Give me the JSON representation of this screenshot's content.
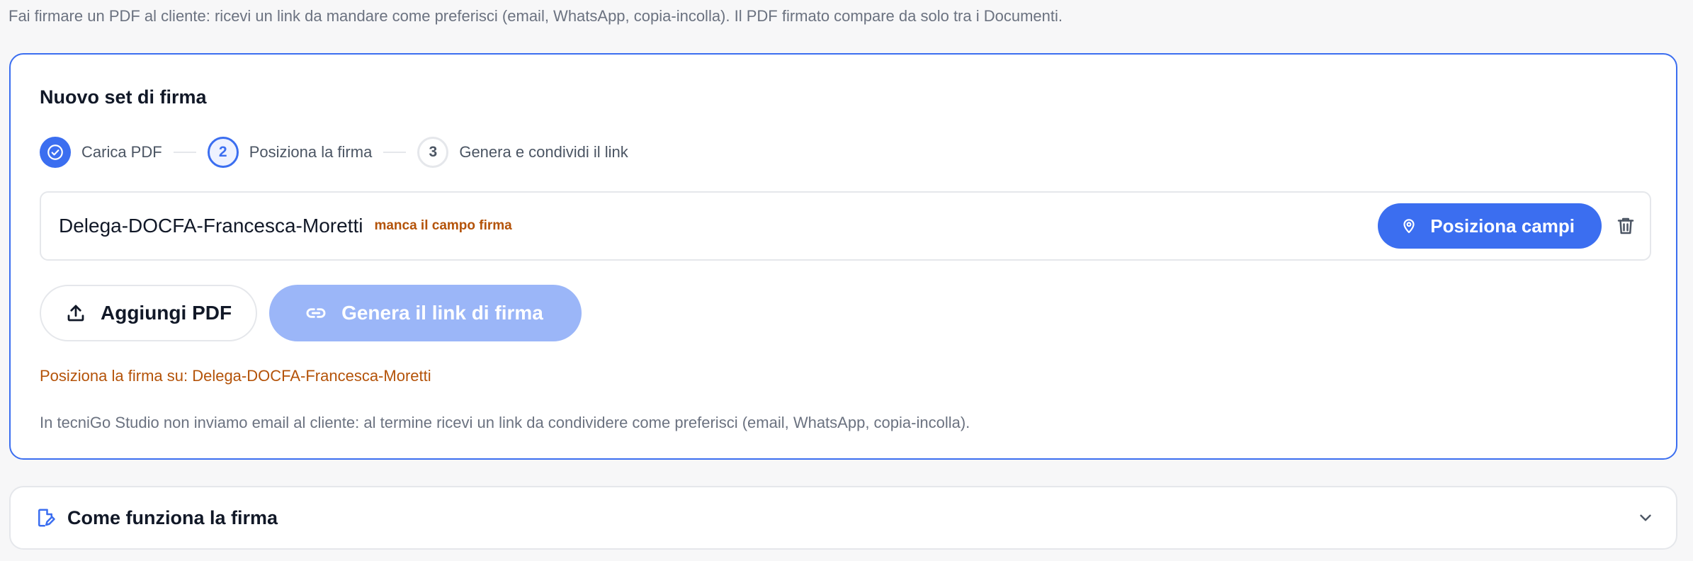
{
  "intro_text": "Fai firmare un PDF al cliente: ricevi un link da mandare come preferisci (email, WhatsApp, copia-incolla). Il PDF firmato compare da solo tra i Documenti.",
  "card": {
    "title": "Nuovo set di firma",
    "steps": [
      {
        "number": "1",
        "label": "Carica PDF",
        "state": "done",
        "icon": "check-circle-icon"
      },
      {
        "number": "2",
        "label": "Posiziona la firma",
        "state": "active"
      },
      {
        "number": "3",
        "label": "Genera e condividi il link",
        "state": "todo"
      }
    ],
    "file": {
      "name": "Delega-DOCFA-Francesca-Moretti",
      "warning": "manca il campo firma",
      "position_button": "Posiziona campi",
      "position_icon": "map-pin-icon",
      "delete_icon": "trash-icon"
    },
    "add_pdf_button": "Aggiungi PDF",
    "add_pdf_icon": "upload-icon",
    "generate_link_button": "Genera il link di firma",
    "generate_link_icon": "link-icon",
    "generate_link_disabled": true,
    "hint_warning": "Posiziona la firma su: Delega-DOCFA-Francesca-Moretti",
    "note": "In tecniGo Studio non inviamo email al cliente: al termine ricevi un link da condividere come preferisci (email, WhatsApp, copia-incolla)."
  },
  "accordion": {
    "title": "Come funziona la firma",
    "icon": "document-edit-icon",
    "chevron": "chevron-down-icon",
    "expanded": false
  },
  "colors": {
    "accent": "#3b6ef0",
    "accent_disabled": "#9bb6f8",
    "warning": "#b45309",
    "muted_text": "#6b7280",
    "border": "#e5e7eb"
  }
}
